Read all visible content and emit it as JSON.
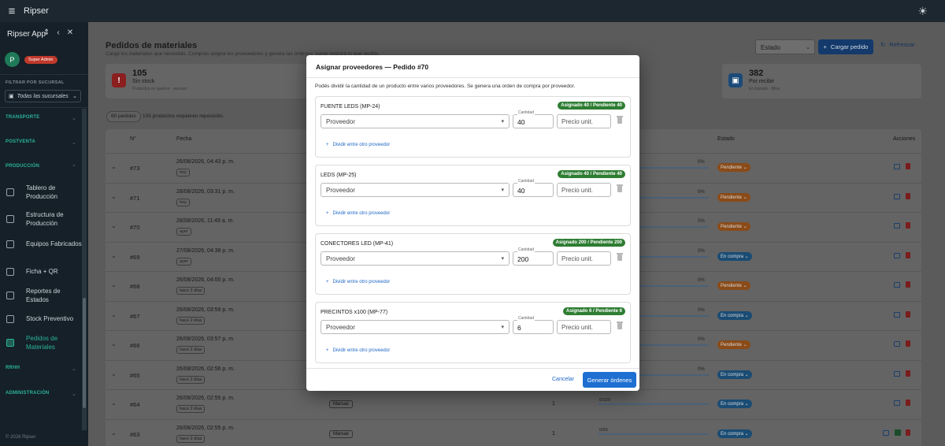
{
  "app": {
    "title": "Ripser"
  },
  "sidebar": {
    "app_name": "Ripser App",
    "user_initial": "P",
    "user_badge": "Super Admin",
    "filter_label": "FILTRAR POR SUCURSAL",
    "filter_value": "Todas las sucursales",
    "sections": [
      "TRANSPORTE",
      "POSTVENTA",
      "PRODUCCIÓN",
      "RRHH",
      "ADMINISTRACIÓN"
    ],
    "items": [
      {
        "label": "Tablero de Producción"
      },
      {
        "label": "Estructura de Producción"
      },
      {
        "label": "Equipos Fabricados"
      },
      {
        "label": "Ficha + QR"
      },
      {
        "label": "Reportes de Estados"
      },
      {
        "label": "Stock Preventivo"
      },
      {
        "label": "Pedidos de Materiales"
      }
    ],
    "footer": "© 2026 Ripser"
  },
  "header": {
    "title": "Pedidos de materiales",
    "subtitle": "Cargá los materiales que necesitás. Compras asigna los proveedores y genera las órdenes; luego registrá lo que recibís.",
    "estado_placeholder": "Estado",
    "cargar_label": "Cargar pedido",
    "refrescar_label": "Refrescar"
  },
  "stats": [
    {
      "value": "105",
      "label": "Sin stock",
      "sub": "Productos en quiebre · reponer",
      "color": "#8b1e1e"
    },
    {
      "value": "382",
      "label": "Por recibir",
      "sub": "En tránsito · filtrar",
      "color": "#1b4a78"
    }
  ],
  "summary": {
    "chip": "60 pedidos",
    "text": "105 productos requieren reposición."
  },
  "table": {
    "headers": {
      "num": "N°",
      "fecha": "Fecha",
      "estado": "Estado",
      "acciones": "Acciones"
    },
    "rows": [
      {
        "num": "#73",
        "fecha": "26/08/2026, 04:43 p. m.",
        "rel": "hoy",
        "estado": "Pendiente",
        "pct": "0%"
      },
      {
        "num": "#71",
        "fecha": "28/08/2026, 03:31 p. m.",
        "rel": "hoy",
        "estado": "Pendiente",
        "pct": "0%"
      },
      {
        "num": "#70",
        "fecha": "28/08/2026, 11:49 a. m.",
        "rel": "ayer",
        "estado": "Pendiente",
        "pct": "0%"
      },
      {
        "num": "#69",
        "fecha": "27/08/2026, 04:38 p. m.",
        "rel": "ayer",
        "estado": "En compra",
        "pct": "0%"
      },
      {
        "num": "#68",
        "fecha": "26/08/2026, 04:00 p. m.",
        "rel": "hace 2 días",
        "estado": "Pendiente",
        "pct": "0%"
      },
      {
        "num": "#67",
        "fecha": "26/08/2026, 03:59 p. m.",
        "rel": "hace 2 días",
        "estado": "En compra",
        "pct": "0%"
      },
      {
        "num": "#66",
        "fecha": "26/08/2026, 03:57 p. m.",
        "rel": "hace 2 días",
        "estado": "Pendiente",
        "pct": "0%"
      },
      {
        "num": "#65",
        "fecha": "26/08/2026, 02:56 p. m.",
        "rel": "hace 2 días",
        "estado": "En compra",
        "pct": "0%"
      },
      {
        "num": "#64",
        "fecha": "26/08/2026, 02:55 p. m.",
        "rel": "hace 2 días",
        "estado": "En compra",
        "pct": "",
        "manual": "Manual",
        "qty": "1",
        "pct2": "0/100"
      },
      {
        "num": "#63",
        "fecha": "26/08/2026, 02:55 p. m.",
        "rel": "hace 2 días",
        "estado": "En compra",
        "pct": "",
        "manual": "Manual",
        "qty": "1",
        "pct2": "0/50"
      }
    ]
  },
  "modal": {
    "title": "Asignar proveedores — Pedido #70",
    "description": "Podés dividir la cantidad de un producto entre varios proveedores. Se genera una orden de compra por proveedor.",
    "provider_placeholder": "Proveedor",
    "qty_label": "Cantidad",
    "price_placeholder": "Precio unit.",
    "split_label": "Dividir entre otro proveedor",
    "products": [
      {
        "name": "FUENTE LEDS (MP-24)",
        "badge": "Asignado 40 / Pendiente 40",
        "qty": "40"
      },
      {
        "name": "LEDS (MP-25)",
        "badge": "Asignado 40 / Pendiente 40",
        "qty": "40"
      },
      {
        "name": "CONECTORES LED (MP-41)",
        "badge": "Asignado 200 / Pendiente 200",
        "qty": "200"
      },
      {
        "name": "PRECINTOS x100 (MP-77)",
        "badge": "Asignado 6 / Pendiente 6",
        "qty": "6"
      }
    ],
    "cancel_label": "Cancelar",
    "generate_label": "Generar órdenes"
  }
}
